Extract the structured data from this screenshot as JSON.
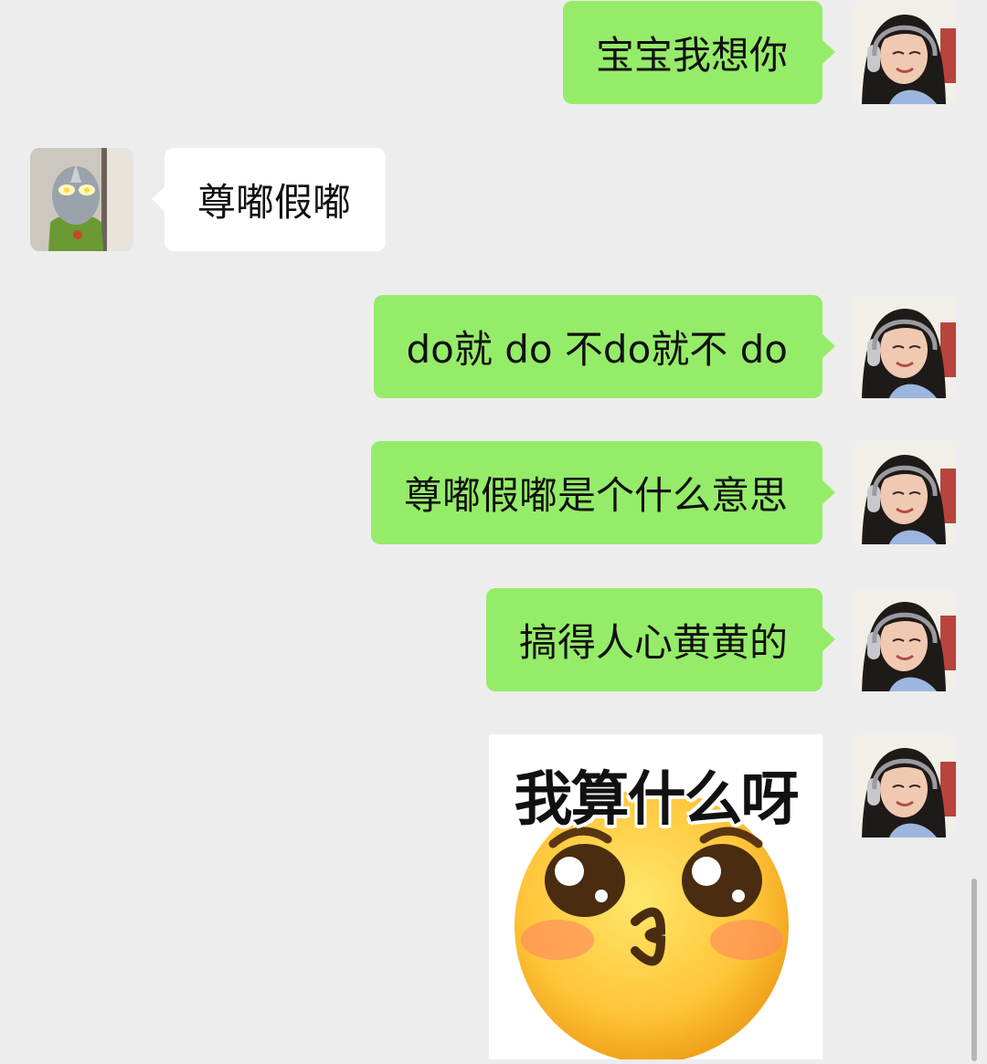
{
  "messages": [
    {
      "side": "out",
      "text": "宝宝我想你"
    },
    {
      "side": "in",
      "text": "尊嘟假嘟"
    },
    {
      "side": "out",
      "text": "do就 do 不do就不 do"
    },
    {
      "side": "out",
      "text": "尊嘟假嘟是个什么意思"
    },
    {
      "side": "out",
      "text": "搞得人心黄黄的"
    }
  ],
  "sticker": {
    "caption": "我算什么呀",
    "icon": "pleading-emoji-icon"
  },
  "colors": {
    "background": "#ededed",
    "outgoing_bubble": "#95ec69",
    "incoming_bubble": "#ffffff"
  }
}
